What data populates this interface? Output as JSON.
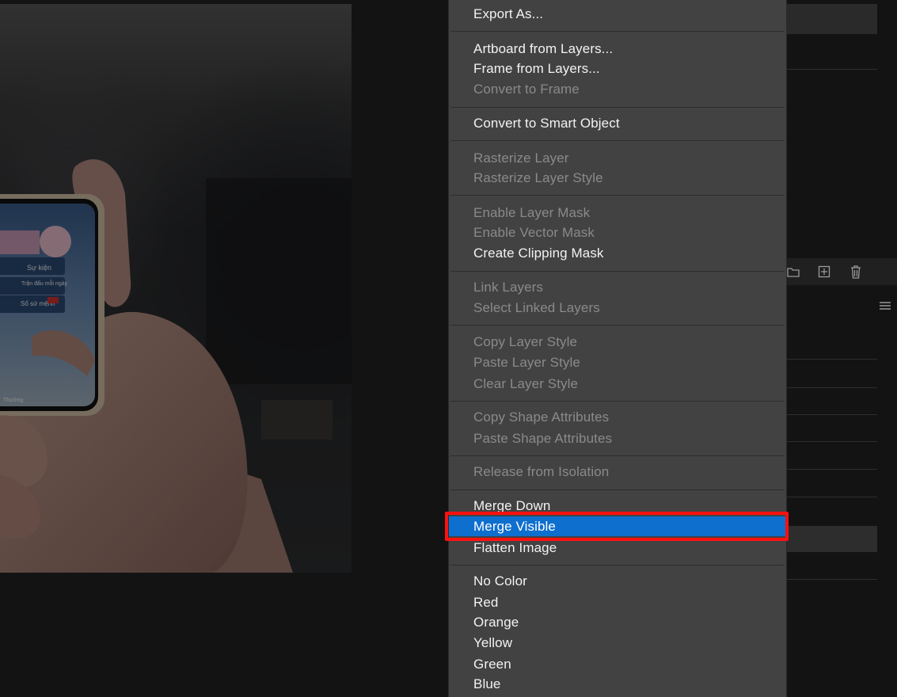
{
  "context_menu": {
    "items": [
      {
        "label": "Export As...",
        "enabled": true
      },
      {
        "label": "Artboard from Layers...",
        "enabled": true
      },
      {
        "label": "Frame from Layers...",
        "enabled": true
      },
      {
        "label": "Convert to Frame",
        "enabled": false
      },
      {
        "label": "Convert to Smart Object",
        "enabled": true
      },
      {
        "label": "Rasterize Layer",
        "enabled": false
      },
      {
        "label": "Rasterize Layer Style",
        "enabled": false
      },
      {
        "label": "Enable Layer Mask",
        "enabled": false
      },
      {
        "label": "Enable Vector Mask",
        "enabled": false
      },
      {
        "label": "Create Clipping Mask",
        "enabled": true
      },
      {
        "label": "Link Layers",
        "enabled": false
      },
      {
        "label": "Select Linked Layers",
        "enabled": false
      },
      {
        "label": "Copy Layer Style",
        "enabled": false
      },
      {
        "label": "Paste Layer Style",
        "enabled": false
      },
      {
        "label": "Clear Layer Style",
        "enabled": false
      },
      {
        "label": "Copy Shape Attributes",
        "enabled": false
      },
      {
        "label": "Paste Shape Attributes",
        "enabled": false
      },
      {
        "label": "Release from Isolation",
        "enabled": false
      },
      {
        "label": "Merge Down",
        "enabled": true
      },
      {
        "label": "Merge Visible",
        "enabled": true,
        "highlighted": true
      },
      {
        "label": "Flatten Image",
        "enabled": true
      },
      {
        "label": "No Color",
        "enabled": true
      },
      {
        "label": "Red",
        "enabled": true
      },
      {
        "label": "Orange",
        "enabled": true
      },
      {
        "label": "Yellow",
        "enabled": true
      },
      {
        "label": "Green",
        "enabled": true
      },
      {
        "label": "Blue",
        "enabled": true
      }
    ]
  },
  "phone_screen": {
    "menu_1": "Sự kiện",
    "menu_2": "Trận đấu mỗi ngày",
    "menu_3": "Sổ sứ mệnh",
    "bottom": "Thưởng"
  },
  "layers_panel": {
    "icons": [
      "folder-icon",
      "new-layer-icon",
      "trash-icon",
      "panel-menu-icon"
    ]
  },
  "colors": {
    "highlight": "#0f6fce",
    "annotation_box": "#ff1010",
    "menu_bg": "#424242"
  }
}
